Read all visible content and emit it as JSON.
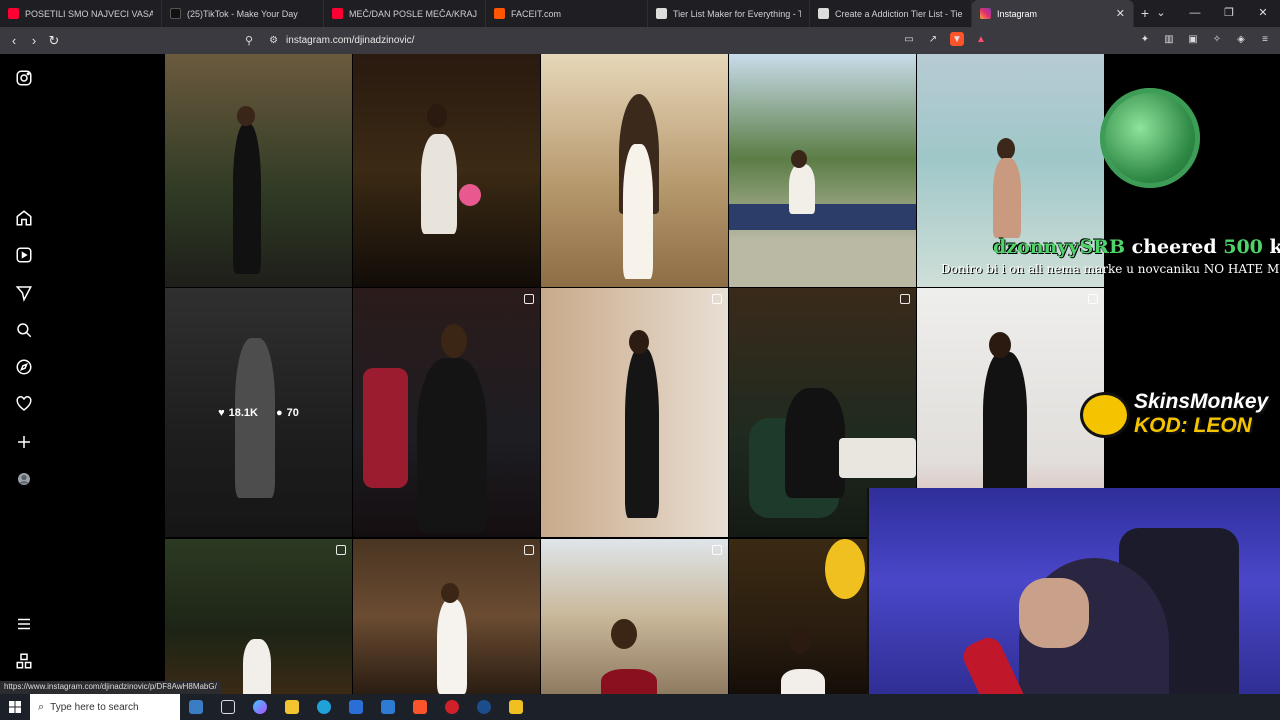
{
  "tabs": [
    {
      "title": "POSETILI SMO NAJVECI VASAR! - Yo",
      "fav": "#ff0033"
    },
    {
      "title": "(25)TikTok - Make Your Day",
      "fav": "#111111"
    },
    {
      "title": "MEČ/DAN POSLE MEČA/KRAJ PRVE",
      "fav": "#ff0033"
    },
    {
      "title": "FACEIT.com",
      "fav": "#ff5500"
    },
    {
      "title": "Tier List Maker for Everything - TierM",
      "fav": "#dddddd"
    },
    {
      "title": "Create a Addiction Tier List - TierMa",
      "fav": "#dddddd"
    },
    {
      "title": "Instagram",
      "fav": "#e1306c"
    }
  ],
  "address": {
    "url": "instagram.com/djinadzinovic/"
  },
  "grid_stats": {
    "likes": "18.1K",
    "comments": "70"
  },
  "stream": {
    "cheer_user": "dzonnyySRB",
    "cheer_mid": "cheered",
    "cheer_amount": "500",
    "cheer_unit": "kicks!",
    "cheer_message": "Doniro bi i on ali nema marke u novcaniku NO HATE MUF!",
    "sponsor_line1": "SkinsMonkey",
    "sponsor_line2": "KOD: LEON"
  },
  "status_url": "https://www.instagram.com/djinadzinovic/p/DF8AwH8MabG/",
  "taskbar": {
    "search_placeholder": "Type here to search"
  }
}
